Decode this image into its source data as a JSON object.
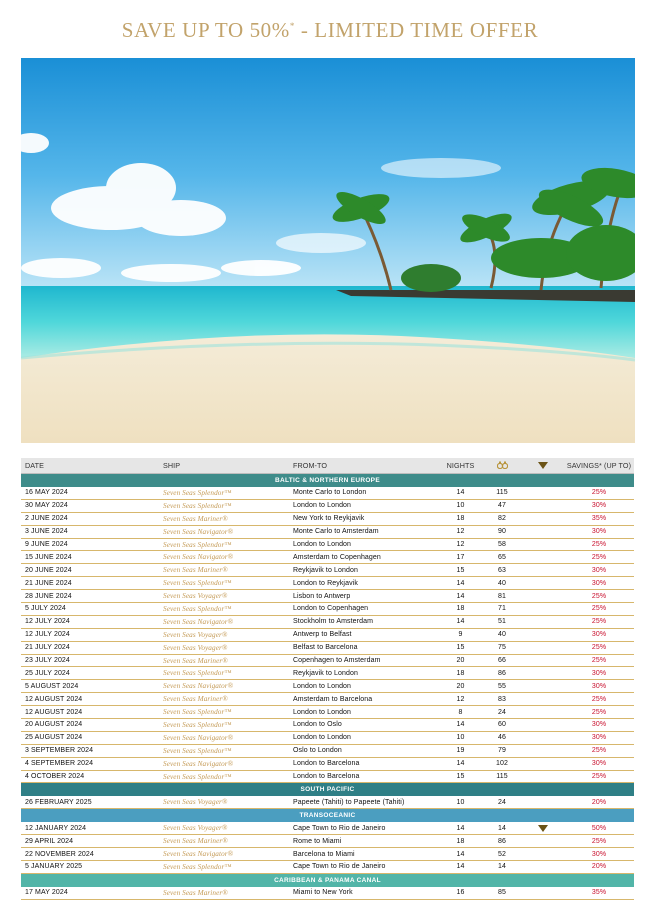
{
  "headline": {
    "prefix": "SAVE UP TO 50%",
    "mark": "*",
    "suffix": " - LIMITED TIME OFFER"
  },
  "colors": {
    "gold": "#c2a36b",
    "teal_section": "#3e8c8a",
    "blue_section": "#4b9ec0",
    "savings_red": "#c8102e"
  },
  "table": {
    "headers": {
      "date": "DATE",
      "ship": "SHIP",
      "route": "FROM-TO",
      "nights": "NIGHTS",
      "points_icon": "binoculars-icon",
      "flag_icon": "triangle-down-icon",
      "savings": "SAVINGS* (UP TO)"
    },
    "sections": [
      {
        "title": "BALTIC & NORTHERN EUROPE",
        "rows": [
          {
            "date": "16 MAY 2024",
            "ship": "Seven Seas Splendor™",
            "route": "Monte Carlo to London",
            "nights": "14",
            "pts": "115",
            "flag": false,
            "savings": "25%"
          },
          {
            "date": "30 MAY 2024",
            "ship": "Seven Seas Splendor™",
            "route": "London to London",
            "nights": "10",
            "pts": "47",
            "flag": false,
            "savings": "30%"
          },
          {
            "date": "2 JUNE 2024",
            "ship": "Seven Seas Mariner®",
            "route": "New York to Reykjavik",
            "nights": "18",
            "pts": "82",
            "flag": false,
            "savings": "35%"
          },
          {
            "date": "3 JUNE 2024",
            "ship": "Seven Seas Navigator®",
            "route": "Monte Carlo to Amsterdam",
            "nights": "12",
            "pts": "90",
            "flag": false,
            "savings": "30%"
          },
          {
            "date": "9 JUNE 2024",
            "ship": "Seven Seas Splendor™",
            "route": "London to London",
            "nights": "12",
            "pts": "58",
            "flag": false,
            "savings": "25%"
          },
          {
            "date": "15 JUNE 2024",
            "ship": "Seven Seas Navigator®",
            "route": "Amsterdam to Copenhagen",
            "nights": "17",
            "pts": "65",
            "flag": false,
            "savings": "25%"
          },
          {
            "date": "20 JUNE 2024",
            "ship": "Seven Seas Mariner®",
            "route": "Reykjavik to London",
            "nights": "15",
            "pts": "63",
            "flag": false,
            "savings": "30%"
          },
          {
            "date": "21 JUNE 2024",
            "ship": "Seven Seas Splendor™",
            "route": "London to Reykjavik",
            "nights": "14",
            "pts": "40",
            "flag": false,
            "savings": "30%"
          },
          {
            "date": "28 JUNE 2024",
            "ship": "Seven Seas Voyager®",
            "route": "Lisbon to Antwerp",
            "nights": "14",
            "pts": "81",
            "flag": false,
            "savings": "25%"
          },
          {
            "date": "5 JULY 2024",
            "ship": "Seven Seas Splendor™",
            "route": "London to Copenhagen",
            "nights": "18",
            "pts": "71",
            "flag": false,
            "savings": "25%"
          },
          {
            "date": "12 JULY 2024",
            "ship": "Seven Seas Navigator®",
            "route": "Stockholm to Amsterdam",
            "nights": "14",
            "pts": "51",
            "flag": false,
            "savings": "25%"
          },
          {
            "date": "12 JULY 2024",
            "ship": "Seven Seas Voyager®",
            "route": "Antwerp to Belfast",
            "nights": "9",
            "pts": "40",
            "flag": false,
            "savings": "30%"
          },
          {
            "date": "21 JULY 2024",
            "ship": "Seven Seas Voyager®",
            "route": "Belfast to Barcelona",
            "nights": "15",
            "pts": "75",
            "flag": false,
            "savings": "25%"
          },
          {
            "date": "23 JULY 2024",
            "ship": "Seven Seas Mariner®",
            "route": "Copenhagen to Amsterdam",
            "nights": "20",
            "pts": "66",
            "flag": false,
            "savings": "25%"
          },
          {
            "date": "25 JULY 2024",
            "ship": "Seven Seas Splendor™",
            "route": "Reykjavik to London",
            "nights": "18",
            "pts": "86",
            "flag": false,
            "savings": "30%"
          },
          {
            "date": "5 AUGUST 2024",
            "ship": "Seven Seas Navigator®",
            "route": "London to London",
            "nights": "20",
            "pts": "55",
            "flag": false,
            "savings": "30%"
          },
          {
            "date": "12 AUGUST 2024",
            "ship": "Seven Seas Mariner®",
            "route": "Amsterdam to Barcelona",
            "nights": "12",
            "pts": "83",
            "flag": false,
            "savings": "25%"
          },
          {
            "date": "12 AUGUST 2024",
            "ship": "Seven Seas Splendor™",
            "route": "London to London",
            "nights": "8",
            "pts": "24",
            "flag": false,
            "savings": "25%"
          },
          {
            "date": "20 AUGUST 2024",
            "ship": "Seven Seas Splendor™",
            "route": "London to Oslo",
            "nights": "14",
            "pts": "60",
            "flag": false,
            "savings": "30%"
          },
          {
            "date": "25 AUGUST 2024",
            "ship": "Seven Seas Navigator®",
            "route": "London to London",
            "nights": "10",
            "pts": "46",
            "flag": false,
            "savings": "30%"
          },
          {
            "date": "3 SEPTEMBER 2024",
            "ship": "Seven Seas Splendor™",
            "route": "Oslo to London",
            "nights": "19",
            "pts": "79",
            "flag": false,
            "savings": "25%"
          },
          {
            "date": "4 SEPTEMBER 2024",
            "ship": "Seven Seas Navigator®",
            "route": "London to Barcelona",
            "nights": "14",
            "pts": "102",
            "flag": false,
            "savings": "30%"
          },
          {
            "date": "4 OCTOBER 2024",
            "ship": "Seven Seas Splendor™",
            "route": "London to Barcelona",
            "nights": "15",
            "pts": "115",
            "flag": false,
            "savings": "25%"
          }
        ]
      },
      {
        "title": "SOUTH PACIFIC",
        "rows": [
          {
            "date": "26 FEBRUARY 2025",
            "ship": "Seven Seas Voyager®",
            "route": "Papeete (Tahiti) to Papeete (Tahiti)",
            "nights": "10",
            "pts": "24",
            "flag": false,
            "savings": "20%"
          }
        ]
      },
      {
        "title": "TRANSOCEANIC",
        "rows": [
          {
            "date": "12 JANUARY 2024",
            "ship": "Seven Seas Voyager®",
            "route": "Cape Town to Rio de Janeiro",
            "nights": "14",
            "pts": "14",
            "flag": true,
            "savings": "50%"
          },
          {
            "date": "29 APRIL 2024",
            "ship": "Seven Seas Mariner®",
            "route": "Rome to Miami",
            "nights": "18",
            "pts": "86",
            "flag": false,
            "savings": "25%"
          },
          {
            "date": "22 NOVEMBER 2024",
            "ship": "Seven Seas Navigator®",
            "route": "Barcelona to Miami",
            "nights": "14",
            "pts": "52",
            "flag": false,
            "savings": "30%"
          },
          {
            "date": "5 JANUARY 2025",
            "ship": "Seven Seas Splendor™",
            "route": "Cape Town to Rio de Janeiro",
            "nights": "14",
            "pts": "14",
            "flag": false,
            "savings": "20%"
          }
        ]
      },
      {
        "title": "CARIBBEAN & PANAMA CANAL",
        "rows": [
          {
            "date": "17 MAY 2024",
            "ship": "Seven Seas Mariner®",
            "route": "Miami to New York",
            "nights": "16",
            "pts": "85",
            "flag": false,
            "savings": "35%"
          }
        ]
      }
    ]
  }
}
